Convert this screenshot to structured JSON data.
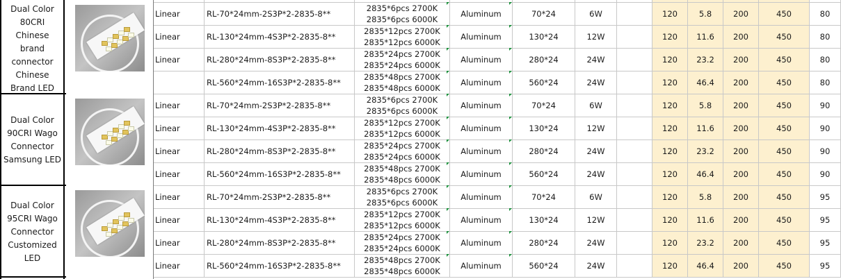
{
  "groups": [
    {
      "label": "Dual Color 80CRI Chinese brand connector Chinese Brand LED",
      "image_name": "led-strip-photo",
      "rows": [
        {
          "type": "Linear",
          "model": "RL-70*24mm-2S3P*2-2835-8**",
          "led1": "2835*6pcs 2700K",
          "led2": "2835*6pcs 6000K",
          "material": "Aluminum",
          "size": "70*24",
          "power": "6W",
          "extra": "",
          "v1": "120",
          "v2": "5.8",
          "v3": "200",
          "v4": "450",
          "cri": "80"
        },
        {
          "type": "Linear",
          "model": "RL-130*24mm-4S3P*2-2835-8**",
          "led1": "2835*12pcs 2700K",
          "led2": "2835*12pcs 6000K",
          "material": "Aluminum",
          "size": "130*24",
          "power": "12W",
          "extra": "",
          "v1": "120",
          "v2": "11.6",
          "v3": "200",
          "v4": "450",
          "cri": "80"
        },
        {
          "type": "Linear",
          "model": "RL-280*24mm-8S3P*2-2835-8**",
          "led1": "2835*24pcs 2700K",
          "led2": "2835*24pcs 6000K",
          "material": "Aluminum",
          "size": "280*24",
          "power": "24W",
          "extra": "",
          "v1": "120",
          "v2": "23.2",
          "v3": "200",
          "v4": "450",
          "cri": "80"
        },
        {
          "type": "",
          "model": "RL-560*24mm-16S3P*2-2835-8**",
          "led1": "2835*48pcs 2700K",
          "led2": "2835*48pcs 6000K",
          "material": "Aluminum",
          "size": "560*24",
          "power": "24W",
          "extra": "",
          "v1": "120",
          "v2": "46.4",
          "v3": "200",
          "v4": "450",
          "cri": "80"
        }
      ]
    },
    {
      "label": "Dual Color 90CRI Wago Connector Samsung LED",
      "image_name": "led-strip-photo",
      "rows": [
        {
          "type": "Linear",
          "model": "RL-70*24mm-2S3P*2-2835-8**",
          "led1": "2835*6pcs 2700K",
          "led2": "2835*6pcs 6000K",
          "material": "Aluminum",
          "size": "70*24",
          "power": "6W",
          "extra": "",
          "v1": "120",
          "v2": "5.8",
          "v3": "200",
          "v4": "450",
          "cri": "90"
        },
        {
          "type": "Linear",
          "model": "RL-130*24mm-4S3P*2-2835-8**",
          "led1": "2835*12pcs 2700K",
          "led2": "2835*12pcs 6000K",
          "material": "Aluminum",
          "size": "130*24",
          "power": "12W",
          "extra": "",
          "v1": "120",
          "v2": "11.6",
          "v3": "200",
          "v4": "450",
          "cri": "90"
        },
        {
          "type": "Linear",
          "model": "RL-280*24mm-8S3P*2-2835-8**",
          "led1": "2835*24pcs 2700K",
          "led2": "2835*24pcs 6000K",
          "material": "Aluminum",
          "size": "280*24",
          "power": "24W",
          "extra": "",
          "v1": "120",
          "v2": "23.2",
          "v3": "200",
          "v4": "450",
          "cri": "90"
        },
        {
          "type": "Linear",
          "model": "RL-560*24mm-16S3P*2-2835-8**",
          "led1": "2835*48pcs 2700K",
          "led2": "2835*48pcs 6000K",
          "material": "Aluminum",
          "size": "560*24",
          "power": "24W",
          "extra": "",
          "v1": "120",
          "v2": "46.4",
          "v3": "200",
          "v4": "450",
          "cri": "90"
        }
      ]
    },
    {
      "label": "Dual Color 95CRI Wago Connector Customized LED",
      "image_name": "led-strip-photo",
      "rows": [
        {
          "type": "Linear",
          "model": "RL-70*24mm-2S3P*2-2835-8**",
          "led1": "2835*6pcs 2700K",
          "led2": "2835*6pcs 6000K",
          "material": "Aluminum",
          "size": "70*24",
          "power": "6W",
          "extra": "",
          "v1": "120",
          "v2": "5.8",
          "v3": "200",
          "v4": "450",
          "cri": "95"
        },
        {
          "type": "Linear",
          "model": "RL-130*24mm-4S3P*2-2835-8**",
          "led1": "2835*12pcs 2700K",
          "led2": "2835*12pcs 6000K",
          "material": "Aluminum",
          "size": "130*24",
          "power": "12W",
          "extra": "",
          "v1": "120",
          "v2": "11.6",
          "v3": "200",
          "v4": "450",
          "cri": "95"
        },
        {
          "type": "Linear",
          "model": "RL-280*24mm-8S3P*2-2835-8**",
          "led1": "2835*24pcs 2700K",
          "led2": "2835*24pcs 6000K",
          "material": "Aluminum",
          "size": "280*24",
          "power": "24W",
          "extra": "",
          "v1": "120",
          "v2": "23.2",
          "v3": "200",
          "v4": "450",
          "cri": "95"
        },
        {
          "type": "Linear",
          "model": "RL-560*24mm-16S3P*2-2835-8**",
          "led1": "2835*48pcs 2700K",
          "led2": "2835*48pcs 6000K",
          "material": "Aluminum",
          "size": "560*24",
          "power": "24W",
          "extra": "",
          "v1": "120",
          "v2": "46.4",
          "v3": "200",
          "v4": "450",
          "cri": "95"
        }
      ]
    }
  ],
  "colors": {
    "highlight": "#fdf0cf",
    "grid": "#c8c8c8",
    "green_marker": "#1a8f3a"
  }
}
